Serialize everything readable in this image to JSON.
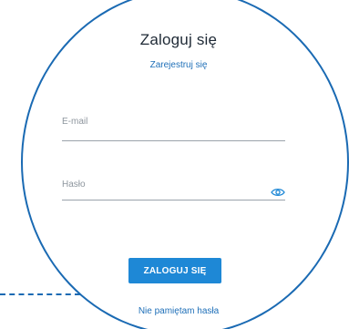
{
  "login_form": {
    "title": "Zaloguj się",
    "register_link": "Zarejestruj się",
    "email_label": "E-mail",
    "password_label": "Hasło",
    "show_password_icon": "eye-icon",
    "submit_label": "ZALOGUJ SIĘ",
    "forgot_password_link": "Nie pamiętam hasła"
  },
  "colors": {
    "accent": "#1a6ab3",
    "button": "#1e88d6",
    "link": "#1e6fb8",
    "title_text": "#1f2a36",
    "placeholder_text": "#8e969e"
  }
}
